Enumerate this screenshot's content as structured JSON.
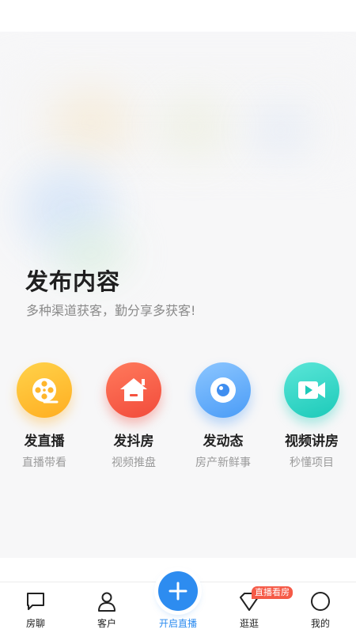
{
  "publish": {
    "title": "发布内容",
    "subtitle": "多种渠道获客，勤分享多获客!"
  },
  "actions": [
    {
      "label": "发直播",
      "sub": "直播带看",
      "icon": "film-reel-icon",
      "color": "#ffb62b"
    },
    {
      "label": "发抖房",
      "sub": "视频推盘",
      "icon": "house-icon",
      "color": "#f5523f"
    },
    {
      "label": "发动态",
      "sub": "房产新鲜事",
      "icon": "camera-lens-icon",
      "color": "#4a9cf7"
    },
    {
      "label": "视频讲房",
      "sub": "秒懂项目",
      "icon": "video-camera-icon",
      "color": "#1ccab9"
    }
  ],
  "tabbar": {
    "items": [
      {
        "label": "房聊",
        "icon": "chat-icon"
      },
      {
        "label": "客户",
        "icon": "person-icon"
      },
      {
        "label": "开启直播",
        "icon": "plus-icon"
      },
      {
        "label": "逛逛",
        "icon": "diamond-icon"
      },
      {
        "label": "我的",
        "icon": "circle-icon"
      }
    ],
    "badge": "直播看房",
    "active_color": "#2d8cf0"
  }
}
